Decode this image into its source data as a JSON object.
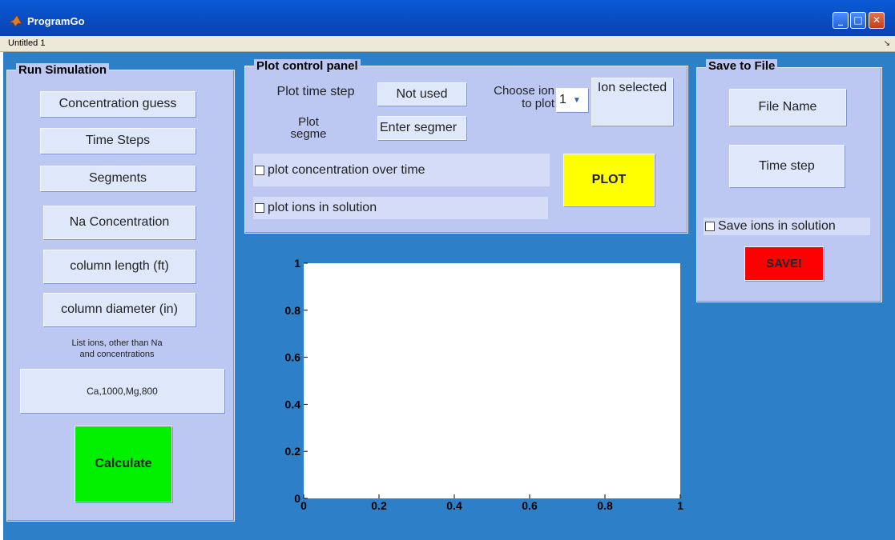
{
  "window": {
    "title": "ProgramGo",
    "menu_doc": "Untitled 1",
    "menu_arrow": "↘",
    "controls": {
      "minimize": "_",
      "maximize": "□",
      "close": "✕"
    }
  },
  "run_simulation": {
    "title": "Run Simulation",
    "buttons": [
      "Concentration guess",
      "Time Steps",
      "Segments",
      "Na Concentration",
      "column length (ft)",
      "column diameter (in)"
    ],
    "ions_label": "List ions, other than Na and concentrations",
    "ions_value": "Ca,1000,Mg,800",
    "calculate_label": "Calculate",
    "calculate_color": "#00f000"
  },
  "plot_control": {
    "title": "Plot control panel",
    "plot_time_step_label": "Plot time step",
    "plot_time_step_value": "Not used",
    "plot_segment_label": "Plot segme",
    "plot_segment_value": "Enter segmer",
    "choose_ion_label": "Choose ion to plot",
    "choose_ion_value": "1",
    "ion_selected_label": "Ion selected",
    "check_concentration": "plot concentration over time",
    "check_ions": "plot ions in solution",
    "plot_button": "PLOT",
    "plot_button_color": "#ffff00"
  },
  "save_to_file": {
    "title": "Save to File",
    "file_name_label": "File Name",
    "time_step_label": "Time step",
    "check_save_ions": "Save ions in solution",
    "save_button": "SAVE!",
    "save_button_color": "#ff0000"
  },
  "chart_data": {
    "type": "line",
    "title": "",
    "xlabel": "",
    "ylabel": "",
    "xlim": [
      0,
      1
    ],
    "ylim": [
      0,
      1
    ],
    "x_ticks": [
      "0",
      "0.2",
      "0.4",
      "0.6",
      "0.8",
      "1"
    ],
    "y_ticks": [
      "0",
      "0.2",
      "0.4",
      "0.6",
      "0.8",
      "1"
    ],
    "series": [],
    "grid": false
  },
  "colors": {
    "figure_background": "#2d7fc8",
    "panel_background": "#bcc8f2"
  }
}
